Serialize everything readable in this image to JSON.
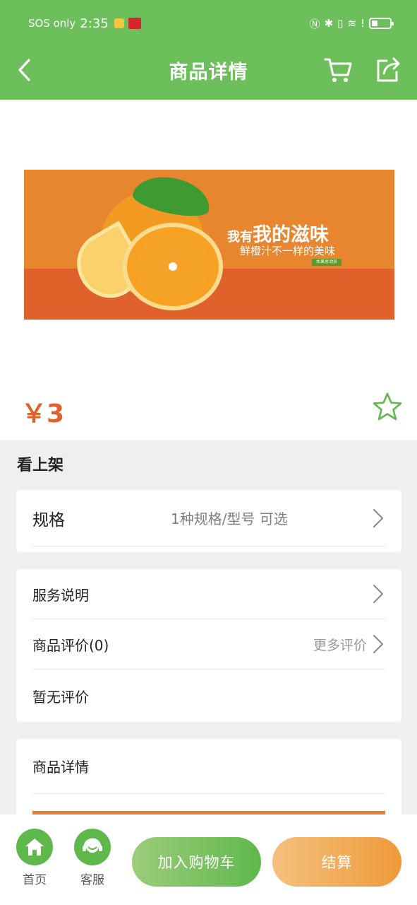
{
  "status_bar": {
    "carrier": "SOS only",
    "time": "2:35"
  },
  "header": {
    "title": "商品详情",
    "back_icon": "chevron-left-icon",
    "cart_icon": "cart-icon",
    "share_icon": "share-icon",
    "background": "#6dbf5b"
  },
  "product": {
    "banner": {
      "slogan_prefix": "我有",
      "slogan_main": "我的滋味",
      "subtitle": "鲜橙汁不一样的美味",
      "tag": "水果总动员"
    },
    "price": "￥3",
    "price_color": "#e0622a",
    "favorite_icon": "star-outline-icon"
  },
  "shop": {
    "name": "看上架"
  },
  "spec": {
    "label": "规格",
    "value": "1种规格/型号 可选"
  },
  "service": {
    "label": "服务说明"
  },
  "reviews": {
    "label": "商品评价(0)",
    "more": "更多评价",
    "empty": "暂无评价"
  },
  "details": {
    "label": "商品详情"
  },
  "bottom_bar": {
    "home_label": "首页",
    "service_label": "客服",
    "add_to_cart": "加入购物车",
    "checkout": "结算",
    "accent_green": "#5fb84c",
    "accent_orange": "#ef9a3a"
  }
}
